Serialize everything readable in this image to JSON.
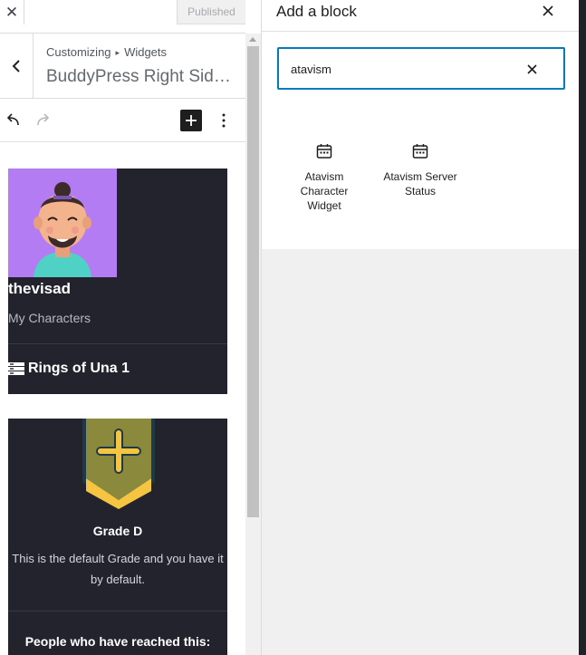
{
  "customizer": {
    "close_icon": "close-icon",
    "publish_label": "Published",
    "breadcrumb": {
      "part1": "Customizing",
      "separator": "▸",
      "part2": "Widgets"
    },
    "section_title": "BuddyPress Right Sideb..."
  },
  "toolbar": {
    "undo_icon": "undo-icon",
    "redo_icon": "redo-icon",
    "add_icon": "plus-icon",
    "more_icon": "kebab-icon"
  },
  "preview": {
    "character_card": {
      "username": "thevisad",
      "subtitle": "My Characters",
      "server": "Rings of Una 1"
    },
    "grade_card": {
      "grade": "Grade D",
      "description": "This is the default Grade and you have it by default.",
      "people_heading": "People who have reached this:"
    }
  },
  "inserter": {
    "title": "Add a block",
    "search": {
      "value": "atavism",
      "placeholder": "Search"
    },
    "results": [
      {
        "label": "Atavism Character Widget",
        "icon": "calendar-widget-icon"
      },
      {
        "label": "Atavism Server Status",
        "icon": "calendar-widget-icon"
      }
    ]
  },
  "colors": {
    "accent": "#007cba",
    "card_bg": "#23232e",
    "avatar_bg": "#b47cf3",
    "badge": "#8b8a3c",
    "ribbon": "#f5c542"
  }
}
